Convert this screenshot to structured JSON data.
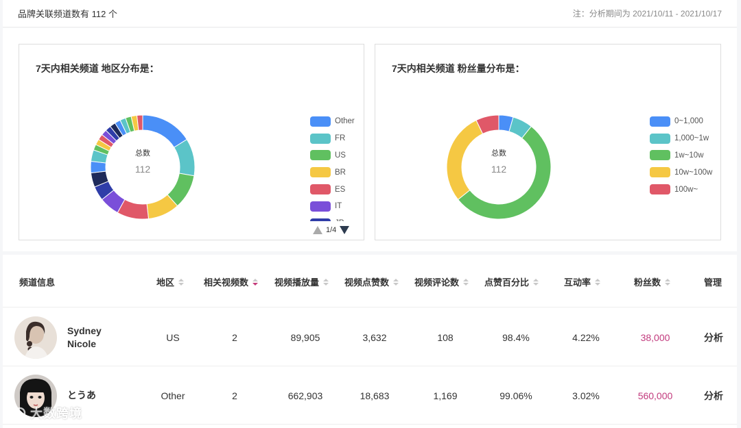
{
  "header": {
    "summary": "品牌关联频道数有 112 个",
    "note": "注：分析期间为 2021/10/11 - 2021/10/17"
  },
  "colors": {
    "blue": "#4a8ff7",
    "teal": "#5bc4c8",
    "green": "#60c060",
    "yellow": "#f5c843",
    "red": "#e05868",
    "purple": "#7a4fd9",
    "navy": "#2f3da8",
    "accent_pink": "#c23a7d"
  },
  "chart_data": [
    {
      "type": "pie",
      "title": "7天内相关频道 地区分布是：",
      "center_label": "总数",
      "center_value": "112",
      "legend_visible": [
        "Other",
        "FR",
        "US",
        "BR",
        "ES",
        "IT",
        "JP"
      ],
      "legend_page": "1/4",
      "slices": [
        {
          "label": "Other",
          "value": 18,
          "color": "#4a8ff7"
        },
        {
          "label": "FR",
          "value": 13,
          "color": "#5bc4c8"
        },
        {
          "label": "US",
          "value": 12,
          "color": "#60c060"
        },
        {
          "label": "BR",
          "value": 11,
          "color": "#f5c843"
        },
        {
          "label": "ES",
          "value": 11,
          "color": "#e05868"
        },
        {
          "label": "IT",
          "value": 7,
          "color": "#7a4fd9"
        },
        {
          "label": "JP",
          "value": 5,
          "color": "#2f3da8"
        },
        {
          "label": "",
          "value": 5,
          "color": "#1e2a5a"
        },
        {
          "label": "",
          "value": 4,
          "color": "#4a8ff7"
        },
        {
          "label": "",
          "value": 4,
          "color": "#5bc4c8"
        },
        {
          "label": "",
          "value": 2,
          "color": "#60c060"
        },
        {
          "label": "",
          "value": 2,
          "color": "#f5c843"
        },
        {
          "label": "",
          "value": 2,
          "color": "#e05868"
        },
        {
          "label": "",
          "value": 2,
          "color": "#7a4fd9"
        },
        {
          "label": "",
          "value": 2,
          "color": "#2f3da8"
        },
        {
          "label": "",
          "value": 2,
          "color": "#1e2a5a"
        },
        {
          "label": "",
          "value": 2,
          "color": "#4a8ff7"
        },
        {
          "label": "",
          "value": 2,
          "color": "#5bc4c8"
        },
        {
          "label": "",
          "value": 2,
          "color": "#60c060"
        },
        {
          "label": "",
          "value": 2,
          "color": "#f5c843"
        },
        {
          "label": "",
          "value": 2,
          "color": "#e05868"
        }
      ]
    },
    {
      "type": "pie",
      "title": "7天内相关频道 粉丝量分布是：",
      "center_label": "总数",
      "center_value": "112",
      "legend_visible": [
        "0~1,000",
        "1,000~1w",
        "1w~10w",
        "10w~100w",
        "100w~"
      ],
      "slices": [
        {
          "label": "0~1,000",
          "value": 5,
          "color": "#4a8ff7"
        },
        {
          "label": "1,000~1w",
          "value": 7,
          "color": "#5bc4c8"
        },
        {
          "label": "1w~10w",
          "value": 60,
          "color": "#60c060"
        },
        {
          "label": "10w~100w",
          "value": 32,
          "color": "#f5c843"
        },
        {
          "label": "100w~",
          "value": 8,
          "color": "#e05868"
        }
      ]
    }
  ],
  "table": {
    "columns": [
      {
        "label": "频道信息",
        "sortable": false
      },
      {
        "label": "地区",
        "sortable": true
      },
      {
        "label": "相关视频数",
        "sortable": true,
        "active_desc": true
      },
      {
        "label": "视频播放量",
        "sortable": true
      },
      {
        "label": "视频点赞数",
        "sortable": true
      },
      {
        "label": "视频评论数",
        "sortable": true
      },
      {
        "label": "点赞百分比",
        "sortable": true
      },
      {
        "label": "互动率",
        "sortable": true
      },
      {
        "label": "粉丝数",
        "sortable": true
      },
      {
        "label": "管理",
        "sortable": false
      }
    ],
    "rows": [
      {
        "name": "Sydney Nicole",
        "region": "US",
        "videos": "2",
        "views": "89,905",
        "likes": "3,632",
        "comments": "108",
        "like_pct": "98.4%",
        "engagement": "4.22%",
        "followers": "38,000",
        "action": "分析"
      },
      {
        "name": "とうあ",
        "region": "Other",
        "videos": "2",
        "views": "662,903",
        "likes": "18,683",
        "comments": "1,169",
        "like_pct": "99.06%",
        "engagement": "3.02%",
        "followers": "560,000",
        "action": "分析"
      }
    ]
  },
  "watermark": "大数跨境"
}
